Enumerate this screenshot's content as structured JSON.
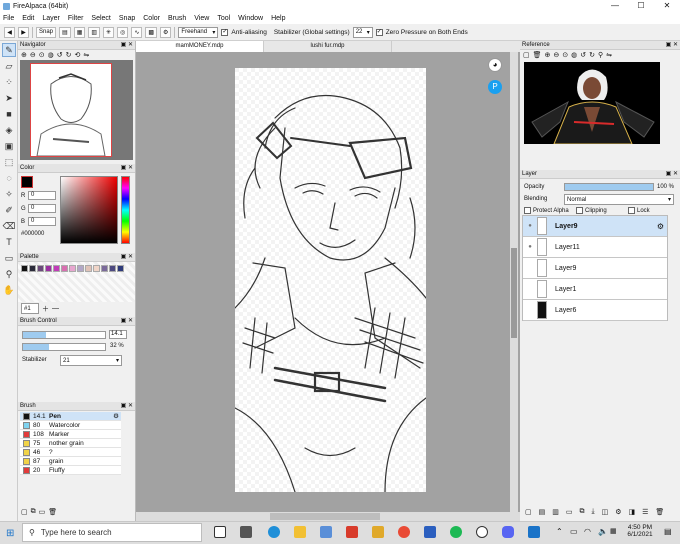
{
  "window": {
    "title": "FireAlpaca (64bit)",
    "minimize": "—",
    "maximize": "☐",
    "close": "✕"
  },
  "menu": [
    "File",
    "Edit",
    "Layer",
    "Filter",
    "Select",
    "Snap",
    "Color",
    "Brush",
    "View",
    "Tool",
    "Window",
    "Help"
  ],
  "toolbar": {
    "snap_label": "Snap",
    "brush_mode": "Freehand",
    "antialiasing_label": "Anti-aliasing",
    "antialiasing_checked": true,
    "stabilizer_label": "Stabilizer (Global settings)",
    "stabilizer_value": "22",
    "zero_pressure_label": "Zero Pressure on Both Ends",
    "zero_pressure_checked": true
  },
  "tabs": [
    {
      "label": "mamMONEY.mdp",
      "active": true
    },
    {
      "label": "lushi fur.mdp",
      "active": false
    }
  ],
  "navigator": {
    "title": "Navigator"
  },
  "color_panel": {
    "title": "Color",
    "r_label": "R",
    "r_value": "0",
    "g_label": "G",
    "g_value": "0",
    "b_label": "B",
    "b_value": "0",
    "hex": "#000000",
    "current_color": "#000000"
  },
  "palette_panel": {
    "title": "Palette",
    "selector": "#1",
    "swatches": [
      "#111111",
      "#2b2b3a",
      "#6a4a7a",
      "#9b2fa1",
      "#c13bb8",
      "#d86fb0",
      "#e7a6cf",
      "#b2a7c7",
      "#e0c3b8",
      "#f0d5c8",
      "#7b6a9a",
      "#4d4a80",
      "#2e3a7a"
    ]
  },
  "brush_control": {
    "title": "Brush Control",
    "size_value": "14.1",
    "size_fraction": 0.28,
    "opacity_value": "32 %",
    "opacity_fraction": 0.32,
    "stabilizer_label": "Stabilizer",
    "stabilizer_value": "21"
  },
  "brush_panel": {
    "title": "Brush",
    "items": [
      {
        "size": "14.1",
        "name": "Pen",
        "color": "#111111",
        "active": true
      },
      {
        "size": "80",
        "name": "Watercolor",
        "color": "#7fd3f0",
        "active": false
      },
      {
        "size": "108",
        "name": "Marker",
        "color": "#e23b3b",
        "active": false
      },
      {
        "size": "75",
        "name": "nother grain",
        "color": "#f1d347",
        "active": false
      },
      {
        "size": "46",
        "name": "?",
        "color": "#f1d347",
        "active": false
      },
      {
        "size": "87",
        "name": "grain",
        "color": "#f1d347",
        "active": false
      },
      {
        "size": "20",
        "name": "Fluffy",
        "color": "#e23b3b",
        "active": false
      }
    ]
  },
  "reference": {
    "title": "Reference"
  },
  "layer_panel": {
    "title": "Layer",
    "opacity_label": "Opacity",
    "opacity_value": "100 %",
    "opacity_fraction": 1.0,
    "blending_label": "Blending",
    "blending_value": "Normal",
    "protect_alpha_label": "Protect Alpha",
    "clipping_label": "Clipping",
    "lock_label": "Lock",
    "layers": [
      {
        "name": "Layer9",
        "active": true,
        "visible": true,
        "dark_thumb": false
      },
      {
        "name": "Layer11",
        "active": false,
        "visible": true,
        "dark_thumb": false
      },
      {
        "name": "Layer9",
        "active": false,
        "visible": false,
        "dark_thumb": false
      },
      {
        "name": "Layer1",
        "active": false,
        "visible": false,
        "dark_thumb": false
      },
      {
        "name": "Layer6",
        "active": false,
        "visible": false,
        "dark_thumb": true
      }
    ]
  },
  "taskbar": {
    "search_placeholder": "Type here to search",
    "time": "4:50 PM",
    "date": "6/1/2021"
  },
  "colors": {
    "accent": "#cfe3f7",
    "canvas_bg": "#a2a2a2"
  }
}
